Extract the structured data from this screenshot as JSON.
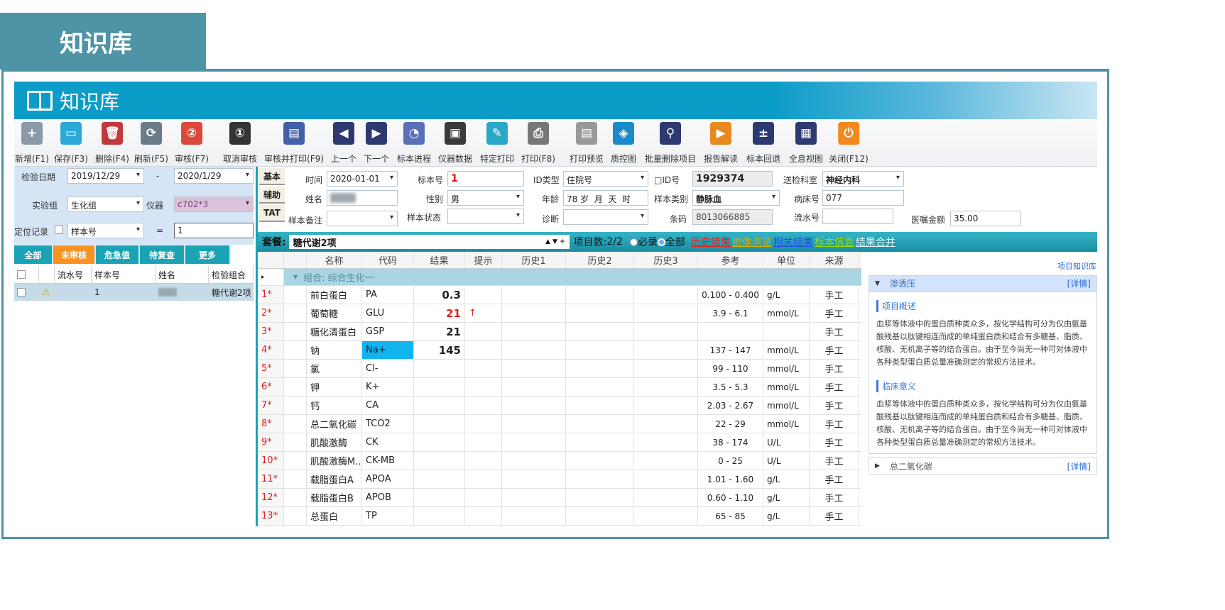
{
  "header_tab": "知识库",
  "app_title": "知识库",
  "toolbar": [
    {
      "label": "新增(F1)",
      "icon": "new-record-icon"
    },
    {
      "label": "保存(F3)",
      "icon": "save-icon"
    },
    {
      "label": "删除(F4)",
      "icon": "trash-icon"
    },
    {
      "label": "刷新(F5)",
      "icon": "refresh-icon"
    },
    {
      "label": "审核(F7)",
      "icon": "audit-icon"
    },
    {
      "label": "取消审核",
      "icon": "cancel-audit-icon"
    },
    {
      "label": "审核并打印(F9)",
      "icon": "audit-print-icon"
    },
    {
      "label": "上一个",
      "icon": "previous-icon"
    },
    {
      "label": "下一个",
      "icon": "next-icon"
    },
    {
      "label": "标本进程",
      "icon": "specimen-progress-icon"
    },
    {
      "label": "仪器数据",
      "icon": "instrument-data-icon"
    },
    {
      "label": "特定打印",
      "icon": "special-print-icon"
    },
    {
      "label": "打印(F8)",
      "icon": "printer-icon"
    },
    {
      "label": "打印预览",
      "icon": "print-preview-icon"
    },
    {
      "label": "质控图",
      "icon": "qc-chart-icon"
    },
    {
      "label": "批量删除项目",
      "icon": "broom-icon"
    },
    {
      "label": "报告解读",
      "icon": "report-interpret-icon"
    },
    {
      "label": "标本回退",
      "icon": "calculator-icon"
    },
    {
      "label": "全息视图",
      "icon": "holographic-view-icon"
    },
    {
      "label": "关闭(F12)",
      "icon": "power-icon"
    }
  ],
  "left": {
    "date_label": "检验日期",
    "date_from": "2019/12/29",
    "date_sep": "-",
    "date_to": "2020/1/29",
    "group_label": "实验组",
    "group": "生化组",
    "instrument_label": "仪器",
    "instrument": "c702*3",
    "locate_label": "定位记录",
    "locate_field": "样本号",
    "eq": "=",
    "locate_value": "1",
    "tabs": [
      "全部",
      "未审核",
      "危急值",
      "待复查",
      "更多"
    ],
    "columns": [
      "流水号",
      "样本号",
      "姓名",
      "检验组合"
    ],
    "rows": [
      {
        "serial": "",
        "sample": "1",
        "name": "",
        "combo": "糖代谢2项"
      }
    ]
  },
  "side_tabs": [
    "基本",
    "辅助",
    "TAT"
  ],
  "form": {
    "time_label": "时间",
    "time": "2020-01-01",
    "sample_no_label": "标本号",
    "sample_no": "1",
    "id_type_label": "ID类型",
    "id_type": "住院号",
    "id_no_label": "□ID号",
    "id_no": "1929374",
    "dept_label": "送检科室",
    "dept": "神经内科",
    "name_label": "姓名",
    "sex_label": "性别",
    "sex": "男",
    "age_label": "年龄",
    "age": "78 岁  月  天  时",
    "sample_type_label": "样本类别",
    "sample_type": "静脉血",
    "bed_label": "病床号",
    "bed": "077",
    "remark_label": "样本备注",
    "status_label": "样本状态",
    "diag_label": "诊断",
    "barcode_label": "条码",
    "barcode": "8013066885",
    "serial_label": "流水号",
    "amount_label": "医嘱金额",
    "amount": "35.00"
  },
  "package": {
    "label": "套餐:",
    "value": "糖代谢2项",
    "arrows": "▲ ▼ +",
    "count_label": "项目数:",
    "count": "2/2",
    "radio_required": "必录",
    "radio_all": "全部",
    "links": [
      {
        "label": "历史结果",
        "color": "#e02020"
      },
      {
        "label": "图像浏览",
        "color": "#d8b000"
      },
      {
        "label": "相关结果",
        "color": "#1f4fe0"
      },
      {
        "label": "标本信息",
        "color": "#9be000"
      },
      {
        "label": "结果合并",
        "color": "#e8f6ff"
      }
    ]
  },
  "grid": {
    "columns": [
      "名称",
      "代码",
      "结果",
      "提示",
      "历史1",
      "历史2",
      "历史3",
      "参考",
      "单位",
      "来源"
    ],
    "group": "组合: 综合生化一",
    "rows": [
      {
        "no": "1*",
        "name": "前白蛋白",
        "code": "PA",
        "result": "0.3",
        "flag": "",
        "ref": "0.100 - 0.400",
        "unit": "g/L",
        "src": "手工"
      },
      {
        "no": "2*",
        "name": "葡萄糖",
        "code": "GLU",
        "result": "21",
        "flag": "↑",
        "ref": "3.9 - 6.1",
        "unit": "mmol/L",
        "src": "手工",
        "abnormal": true
      },
      {
        "no": "3*",
        "name": "糖化清蛋白",
        "code": "GSP",
        "result": "21",
        "flag": "",
        "ref": "",
        "unit": "",
        "src": "手工"
      },
      {
        "no": "4*",
        "name": "钠",
        "code": "Na+",
        "result": "145",
        "flag": "",
        "ref": "137 - 147",
        "unit": "mmol/L",
        "src": "手工",
        "selected": true
      },
      {
        "no": "5*",
        "name": "氯",
        "code": "Cl-",
        "result": "",
        "flag": "",
        "ref": "99 - 110",
        "unit": "mmol/L",
        "src": "手工"
      },
      {
        "no": "6*",
        "name": "钾",
        "code": "K+",
        "result": "",
        "flag": "",
        "ref": "3.5 - 5.3",
        "unit": "mmol/L",
        "src": "手工"
      },
      {
        "no": "7*",
        "name": "钙",
        "code": "CA",
        "result": "",
        "flag": "",
        "ref": "2.03 - 2.67",
        "unit": "mmol/L",
        "src": "手工"
      },
      {
        "no": "8*",
        "name": "总二氧化碳",
        "code": "TCO2",
        "result": "",
        "flag": "",
        "ref": "22 - 29",
        "unit": "mmol/L",
        "src": "手工"
      },
      {
        "no": "9*",
        "name": "肌酸激酶",
        "code": "CK",
        "result": "",
        "flag": "",
        "ref": "38 - 174",
        "unit": "U/L",
        "src": "手工"
      },
      {
        "no": "10*",
        "name": "肌酸激酶M...",
        "code": "CK-MB",
        "result": "",
        "flag": "",
        "ref": "0 - 25",
        "unit": "U/L",
        "src": "手工"
      },
      {
        "no": "11*",
        "name": "载脂蛋白A",
        "code": "APOA",
        "result": "",
        "flag": "",
        "ref": "1.01 - 1.60",
        "unit": "g/L",
        "src": "手工"
      },
      {
        "no": "12*",
        "name": "载脂蛋白B",
        "code": "APOB",
        "result": "",
        "flag": "",
        "ref": "0.60 - 1.10",
        "unit": "g/L",
        "src": "手工"
      },
      {
        "no": "13*",
        "name": "总蛋白",
        "code": "TP",
        "result": "",
        "flag": "",
        "ref": "65 - 85",
        "unit": "g/L",
        "src": "手工"
      }
    ]
  },
  "knowledge": {
    "link": "项目知识库",
    "item1": {
      "title": "渗透压",
      "detail": "[详情]",
      "overview_title": "项目概述",
      "overview": "血浆等体液中的蛋白质种类众多，按化学结构可分为仅由氨基酸残基以肽键相连而成的单纯蛋白质和结合有多糖基、脂质、核酸、无机离子等的结合蛋白。由于至今尚无一种可对体液中各种类型蛋白质总量准确测定的常规方法技术。",
      "clinical_title": "临床意义",
      "clinical": "血浆等体液中的蛋白质种类众多，按化学结构可分为仅由氨基酸残基以肽键相连而成的单纯蛋白质和结合有多糖基、脂质、核酸、无机离子等的结合蛋白。由于至今尚无一种可对体液中各种类型蛋白质总量准确测定的常规方法技术。"
    },
    "item2": {
      "title": "总二氧化碳",
      "detail": "[详情]"
    }
  }
}
